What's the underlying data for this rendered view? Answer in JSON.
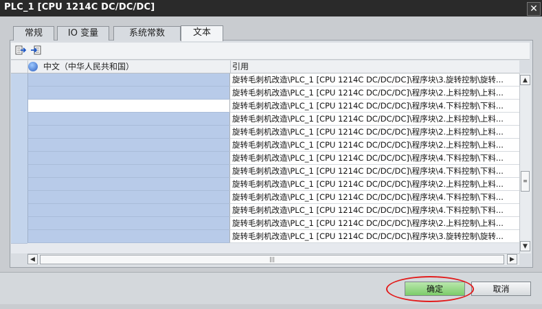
{
  "window": {
    "title": "PLC_1 [CPU 1214C DC/DC/DC]",
    "close_glyph": "✕"
  },
  "tabs": [
    {
      "label": "常规"
    },
    {
      "label": "IO 变量"
    },
    {
      "label": "系统常数"
    },
    {
      "label": "文本"
    }
  ],
  "table": {
    "col1_header": "中文（中华人民共和国）",
    "col2_header": "引用",
    "rows": [
      {
        "ref": "旋转毛刺机改造\\PLC_1 [CPU 1214C DC/DC/DC]\\程序块\\3.旋转控制\\旋转..."
      },
      {
        "ref": "旋转毛刺机改造\\PLC_1 [CPU 1214C DC/DC/DC]\\程序块\\2.上料控制\\上料..."
      },
      {
        "ref": "旋转毛刺机改造\\PLC_1 [CPU 1214C DC/DC/DC]\\程序块\\4.下料控制\\下料..."
      },
      {
        "ref": "旋转毛刺机改造\\PLC_1 [CPU 1214C DC/DC/DC]\\程序块\\2.上料控制\\上料..."
      },
      {
        "ref": "旋转毛刺机改造\\PLC_1 [CPU 1214C DC/DC/DC]\\程序块\\2.上料控制\\上料..."
      },
      {
        "ref": "旋转毛刺机改造\\PLC_1 [CPU 1214C DC/DC/DC]\\程序块\\2.上料控制\\上料..."
      },
      {
        "ref": "旋转毛刺机改造\\PLC_1 [CPU 1214C DC/DC/DC]\\程序块\\4.下料控制\\下料..."
      },
      {
        "ref": "旋转毛刺机改造\\PLC_1 [CPU 1214C DC/DC/DC]\\程序块\\4.下料控制\\下料..."
      },
      {
        "ref": "旋转毛刺机改造\\PLC_1 [CPU 1214C DC/DC/DC]\\程序块\\2.上料控制\\上料..."
      },
      {
        "ref": "旋转毛刺机改造\\PLC_1 [CPU 1214C DC/DC/DC]\\程序块\\4.下料控制\\下料..."
      },
      {
        "ref": "旋转毛刺机改造\\PLC_1 [CPU 1214C DC/DC/DC]\\程序块\\4.下料控制\\下料..."
      },
      {
        "ref": "旋转毛刺机改造\\PLC_1 [CPU 1214C DC/DC/DC]\\程序块\\2.上料控制\\上料..."
      },
      {
        "ref": "旋转毛刺机改造\\PLC_1 [CPU 1214C DC/DC/DC]\\程序块\\3.旋转控制\\旋转..."
      }
    ]
  },
  "buttons": {
    "ok": "确定",
    "cancel": "取消"
  },
  "colors": {
    "highlight": "#e21b1b",
    "ok_button": "#7ccc6a",
    "row_fill": "#b8cbe9"
  }
}
